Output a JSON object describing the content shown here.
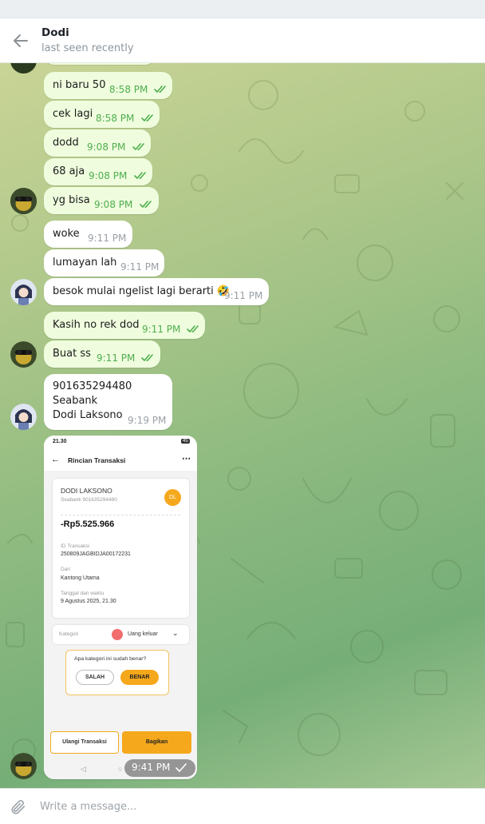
{
  "header": {
    "back_icon": "arrow-left-icon",
    "chat_name": "Dodi",
    "status": "last seen recently"
  },
  "messages": [
    {
      "dir": "out",
      "text": "ni baru 50",
      "time": "8:58 PM",
      "status": "read"
    },
    {
      "dir": "out",
      "text": "cek lagi",
      "time": "8:58 PM",
      "status": "read"
    },
    {
      "dir": "out",
      "text": "dodd",
      "time": "9:08 PM",
      "status": "read"
    },
    {
      "dir": "out",
      "text": "68 aja",
      "time": "9:08 PM",
      "status": "read"
    },
    {
      "dir": "out",
      "text": "yg bisa",
      "time": "9:08 PM",
      "status": "read"
    },
    {
      "dir": "in",
      "text": "woke",
      "time": "9:11 PM"
    },
    {
      "dir": "in",
      "text": "lumayan lah",
      "time": "9:11 PM"
    },
    {
      "dir": "in",
      "text": "besok mulai ngelist lagi berarti 🤣",
      "time": "9:11 PM"
    },
    {
      "dir": "out",
      "text": "Kasih no rek dod",
      "time": "9:11 PM",
      "status": "read"
    },
    {
      "dir": "out",
      "text": "Buat ss",
      "time": "9:11 PM",
      "status": "read"
    },
    {
      "dir": "in",
      "text": "901635294480\nSeabank\nDodi Laksono",
      "time": "9:19 PM"
    }
  ],
  "screenshot": {
    "statusbar_time": "21.30",
    "battery": "45",
    "title": "Rincian Transaksi",
    "recipient_name": "DODI LAKSONO",
    "recipient_sub": "Seabank 901635294480",
    "avatar_initials": "DL",
    "amount": "-Rp5.525.966",
    "id_label": "ID Transaksi",
    "id_value": "250809JAGBIDJA00172231",
    "from_label": "Dari",
    "from_value": "Kantong Utama",
    "date_label": "Tanggal dan waktu",
    "date_value": "9 Agustus 2025, 21.30",
    "category_label": "Kategori",
    "category_value": "Uang keluar",
    "question": "Apa kategori ini sudah benar?",
    "btn_no": "SALAH",
    "btn_yes": "BENAR",
    "btn_repeat": "Ulangi Transaksi",
    "btn_share": "Bagikan",
    "accent": "#f5a81c"
  },
  "media_message": {
    "time": "9:41 PM",
    "status": "sent"
  },
  "composer": {
    "placeholder": "Write a message...",
    "attach_icon": "paperclip-icon"
  },
  "colors": {
    "outgoing_bubble": "#effdde",
    "incoming_bubble": "#ffffff",
    "read_tick": "#4fae4e",
    "wallpaper": "#8dba80"
  }
}
